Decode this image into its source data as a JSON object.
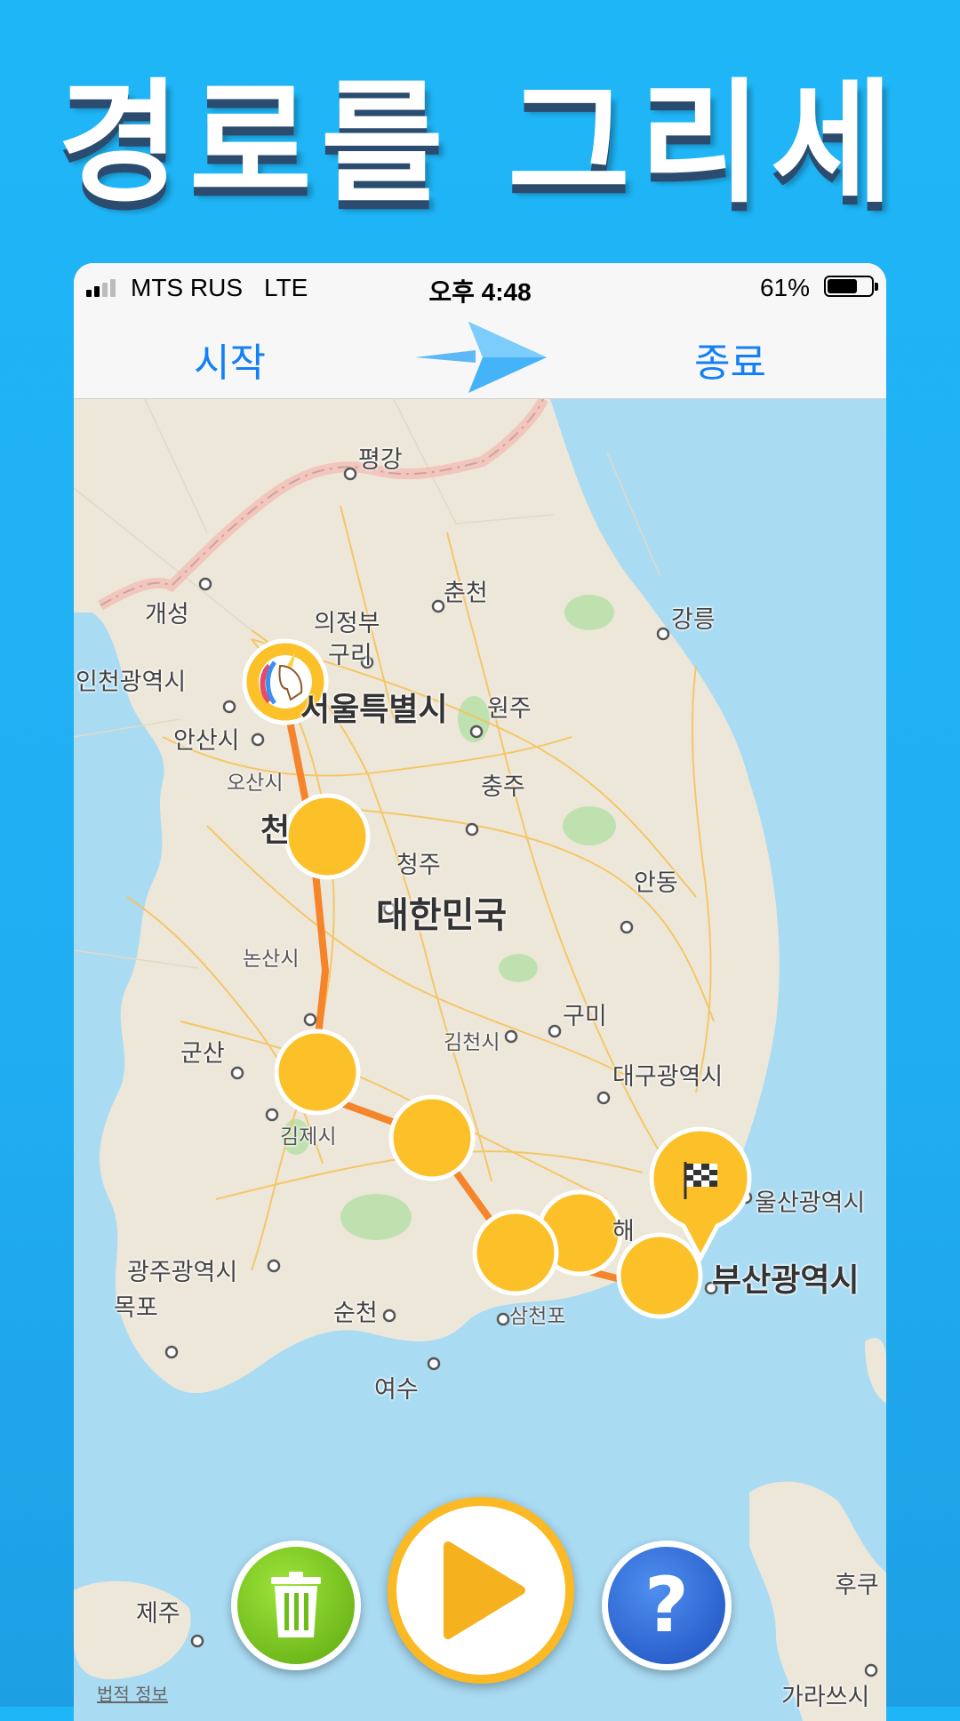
{
  "headline": "경로를 그리세요",
  "status_bar": {
    "carrier": "MTS RUS",
    "network": "LTE",
    "time": "오후 4:48",
    "battery_percent": "61%",
    "battery_level": 0.61
  },
  "nav": {
    "start_label": "시작",
    "end_label": "종료",
    "center_icon": "paper-plane-icon"
  },
  "map": {
    "region": "대한민국",
    "cities": {
      "pyongang": "평강",
      "kaesong": "개성",
      "chuncheon": "춘천",
      "uijeongbu": "의정부",
      "gangneung": "강릉",
      "guri": "구리",
      "incheon": "인천광역시",
      "seoul": "서울특별시",
      "wonju": "원주",
      "ansan": "안산시",
      "osan": "오산시",
      "cheonan": "천",
      "chungju": "충주",
      "cheongju": "청주",
      "andong": "안동",
      "korea": "대한민국",
      "nonsan": "논산시",
      "gumi": "구미",
      "gunsan": "군산",
      "gimcheon": "김천시",
      "daegu": "대구광역시",
      "gimje": "김제시",
      "ulsan": "울산광역시",
      "gimhae": "해",
      "gwangju": "광주광역시",
      "busan": "부산광역시",
      "mokpo": "목포",
      "suncheon": "순천",
      "samcheonpo": "삼천포",
      "yeosu": "여수",
      "jeju": "제주",
      "fukuoka": "후쿠",
      "karatsu": "가라쓰시"
    },
    "legal_link": "법적 정보",
    "start_marker_icon": "unicorn-icon",
    "finish_marker_icon": "checkered-flag-icon",
    "waypoint_count": 7
  },
  "controls": {
    "delete_icon": "trash-icon",
    "play_icon": "play-icon",
    "help_label": "?"
  },
  "colors": {
    "background": "#1fb6f7",
    "nav_accent": "#1480f5",
    "route": "#f5842a",
    "waypoint": "#fcc129",
    "land": "#ede7d9",
    "sea": "#a9dbf3",
    "trash_button": "#6fbd1b",
    "play_ring": "#fbb923",
    "help_button": "#2c66d8"
  }
}
